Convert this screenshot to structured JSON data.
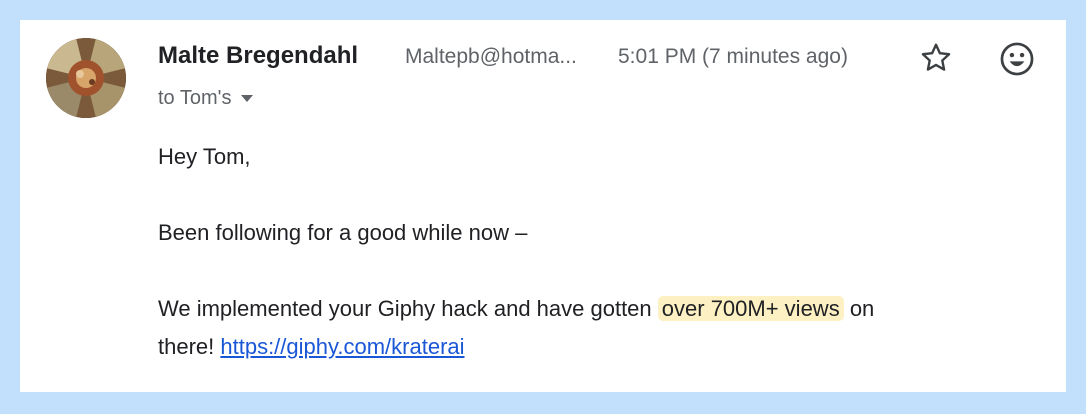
{
  "message": {
    "sender_name": "Malte Bregendahl",
    "sender_email": "Maltepb@hotma...",
    "time": "5:01 PM (7 minutes ago)",
    "recipients": "to Tom's",
    "icons": {
      "star": "star-outline-icon",
      "emoji": "emoji-react-icon",
      "caret": "caret-down-icon"
    }
  },
  "body": {
    "greeting": "Hey Tom,",
    "line1": "Been following for a good while now –",
    "line2_before": "We implemented your Giphy hack and have gotten ",
    "line2_highlight": "over 700M+ views",
    "line2_after": " on",
    "line3_before": "there! ",
    "link_text": "https://giphy.com/kraterai"
  },
  "colors": {
    "frame_background": "#c2e0fb",
    "highlight": "#fdf1c4",
    "link": "#1a57d6"
  }
}
